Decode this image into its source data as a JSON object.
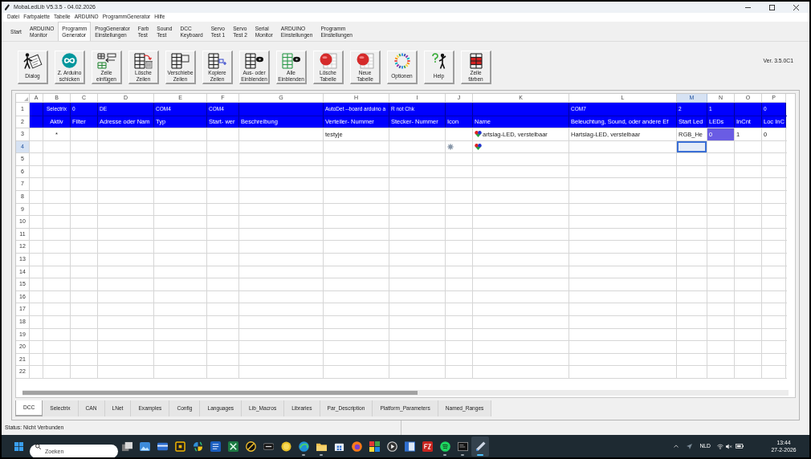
{
  "window": {
    "title": "MobaLedLib V5.3.5 - 04.02.2026"
  },
  "menu": [
    "Datei",
    "Farbpalette",
    "Tabelle",
    "ARDUINO",
    "ProgrammGenerator",
    "Hilfe"
  ],
  "tabs": [
    {
      "label": "Start",
      "selected": false
    },
    {
      "label": "ARDUINO\nMonitor",
      "selected": false
    },
    {
      "label": "Programm\nGenerator",
      "selected": true
    },
    {
      "label": "ProgGenerator\nEinstellungen",
      "selected": false
    },
    {
      "label": "Farb\nTest",
      "selected": false
    },
    {
      "label": "Sound\nTest",
      "selected": false
    },
    {
      "label": "DCC\nKeyboard",
      "selected": false
    },
    {
      "label": "Servo\nTest 1",
      "selected": false
    },
    {
      "label": "Servo\nTest 2",
      "selected": false
    },
    {
      "label": "Serial\nMonitor",
      "selected": false
    },
    {
      "label": "ARDUINO\nEinstellungen",
      "selected": false
    },
    {
      "label": "Programm\nEinstellungen",
      "selected": false
    }
  ],
  "toolbar": {
    "buttons": [
      {
        "kind": "dialog",
        "label": "Dialog"
      },
      {
        "kind": "upload",
        "label": "Z. Arduino\nschicken"
      },
      {
        "kind": "insert",
        "label": "Zeile\neinfügen"
      },
      {
        "kind": "delete",
        "label": "Lösche\nZeilen"
      },
      {
        "kind": "move",
        "label": "Verschiebe\nZeilen"
      },
      {
        "kind": "copy",
        "label": "Kopiere\nZeilen"
      },
      {
        "kind": "toggle",
        "label": "Aus- oder\nEinblenden"
      },
      {
        "kind": "show",
        "label": "Alle\nEinblenden"
      },
      {
        "kind": "clear",
        "label": "Lösche\nTabelle"
      },
      {
        "kind": "new",
        "label": "Neue\nTabelle"
      },
      {
        "kind": "options",
        "label": "Optionen"
      },
      {
        "kind": "help",
        "label": "Help"
      },
      {
        "kind": "paint",
        "label": "Zeile\nfärben"
      }
    ],
    "version": "Ver. 3.5.0C1"
  },
  "sheet": {
    "columns": [
      {
        "label": "A",
        "selected": false
      },
      {
        "label": "B",
        "selected": false
      },
      {
        "label": "C",
        "selected": false
      },
      {
        "label": "D",
        "selected": false
      },
      {
        "label": "E",
        "selected": false
      },
      {
        "label": "F",
        "selected": false
      },
      {
        "label": "G",
        "selected": false
      },
      {
        "label": "H",
        "selected": false
      },
      {
        "label": "I",
        "selected": false
      },
      {
        "label": "J",
        "selected": false
      },
      {
        "label": "K",
        "selected": false
      },
      {
        "label": "L",
        "selected": false
      },
      {
        "label": "M",
        "selected": true
      },
      {
        "label": "N",
        "selected": false
      },
      {
        "label": "O",
        "selected": false
      },
      {
        "label": "P",
        "selected": false
      }
    ],
    "rows": [
      {
        "number": "1",
        "kind": "config",
        "selected": false,
        "cells": [
          null,
          {
            "text": "Selectrix"
          },
          {
            "text": "0"
          },
          {
            "text": "DE"
          },
          {
            "text": "COM4"
          },
          {
            "text": "COM4"
          },
          null,
          {
            "text": "AutoDet --board arduino a"
          },
          {
            "text": "R not Chk"
          },
          null,
          null,
          {
            "text": "COM7"
          },
          {
            "text": "2"
          },
          {
            "text": "1"
          },
          null,
          {
            "text": "0"
          }
        ]
      },
      {
        "number": "2",
        "kind": "header",
        "selected": false,
        "cells": [
          null,
          {
            "text": "Aktiv"
          },
          {
            "text": "Filter"
          },
          {
            "text": "Adresse oder Nam"
          },
          {
            "text": "Typ"
          },
          {
            "text": "Start- wer"
          },
          {
            "text": "Beschreibung"
          },
          {
            "text": "Verteiler- Nummer"
          },
          {
            "text": "Stecker- Nummer"
          },
          {
            "text": "Icon"
          },
          {
            "text": "Name"
          },
          {
            "text": "Beleuchtung, Sound, oder andere Ef"
          },
          {
            "text": "Start Led"
          },
          {
            "text": "LEDs"
          },
          {
            "text": "InCnt"
          },
          {
            "text": "Loc InC"
          }
        ]
      },
      {
        "number": "3",
        "kind": "data",
        "selected": false,
        "cells": [
          null,
          {
            "text": "*"
          },
          null,
          null,
          null,
          null,
          null,
          {
            "text": "testyje"
          },
          null,
          null,
          {
            "kind": "led",
            "text": "artslag-LED, verstelbaar"
          },
          {
            "text": "Hartslag-LED, verstelbaar"
          },
          {
            "text": "RGB_He"
          },
          {
            "text": "0",
            "color": "#6a5ce4"
          },
          {
            "text": "1"
          },
          {
            "text": "0"
          }
        ]
      },
      {
        "number": "4",
        "kind": "data",
        "selected": true,
        "cells": [
          null,
          null,
          null,
          null,
          null,
          null,
          null,
          null,
          null,
          {
            "kind": "symbol"
          },
          {
            "kind": "led"
          },
          null,
          null,
          null,
          null,
          null
        ]
      },
      {
        "number": "5",
        "kind": "data",
        "selected": false
      },
      {
        "number": "6",
        "kind": "data",
        "selected": false
      },
      {
        "number": "7",
        "kind": "data",
        "selected": false
      },
      {
        "number": "8",
        "kind": "data",
        "selected": false
      },
      {
        "number": "9",
        "kind": "data",
        "selected": false
      },
      {
        "number": "10",
        "kind": "data",
        "selected": false
      },
      {
        "number": "11",
        "kind": "data",
        "selected": false
      },
      {
        "number": "12",
        "kind": "data",
        "selected": false
      },
      {
        "number": "13",
        "kind": "data",
        "selected": false
      },
      {
        "number": "14",
        "kind": "data",
        "selected": false
      },
      {
        "number": "15",
        "kind": "data",
        "selected": false
      },
      {
        "number": "16",
        "kind": "data",
        "selected": false
      },
      {
        "number": "17",
        "kind": "data",
        "selected": false
      },
      {
        "number": "18",
        "kind": "data",
        "selected": false
      },
      {
        "number": "19",
        "kind": "data",
        "selected": false
      },
      {
        "number": "20",
        "kind": "data",
        "selected": false
      },
      {
        "number": "21",
        "kind": "data",
        "selected": false
      },
      {
        "number": "22",
        "kind": "data",
        "selected": false
      }
    ]
  },
  "sheet_tabs": [
    {
      "label": "DCC",
      "selected": true
    },
    {
      "label": "Selectrix",
      "selected": false
    },
    {
      "label": "CAN",
      "selected": false
    },
    {
      "label": "LNet",
      "selected": false
    },
    {
      "label": "Examples",
      "selected": false
    },
    {
      "label": "Config",
      "selected": false
    },
    {
      "label": "Languages",
      "selected": false
    },
    {
      "label": "Lib_Macros",
      "selected": false
    },
    {
      "label": "Libraries",
      "selected": false
    },
    {
      "label": "Par_Description",
      "selected": false
    },
    {
      "label": "Platform_Parameters",
      "selected": false
    },
    {
      "label": "Named_Ranges",
      "selected": false
    }
  ],
  "status_bar": "Status: Nicht Verbunden",
  "taskbar": {
    "search": {
      "placeholder": "Zoeken"
    },
    "apps": [
      {
        "kind": "tasks",
        "running": false,
        "active": false
      },
      {
        "kind": "photos",
        "running": false,
        "active": false
      },
      {
        "kind": "card",
        "running": false,
        "active": false
      },
      {
        "kind": "frame",
        "running": false,
        "active": false
      },
      {
        "kind": "twin",
        "running": false,
        "active": false
      },
      {
        "kind": "word",
        "running": false,
        "active": false
      },
      {
        "kind": "excel",
        "running": false,
        "active": false
      },
      {
        "kind": "compass",
        "running": false,
        "active": false
      },
      {
        "kind": "badge",
        "running": false,
        "active": false
      },
      {
        "kind": "coin",
        "running": false,
        "active": false
      },
      {
        "kind": "browser",
        "running": true,
        "active": false
      },
      {
        "kind": "folder",
        "running": true,
        "active": false
      },
      {
        "kind": "store",
        "running": false,
        "active": false
      },
      {
        "kind": "fox",
        "running": false,
        "active": false
      },
      {
        "kind": "tiles",
        "running": false,
        "active": false
      },
      {
        "kind": "player",
        "running": false,
        "active": false
      },
      {
        "kind": "panel",
        "running": false,
        "active": false
      },
      {
        "kind": "transfer",
        "running": false,
        "active": false
      },
      {
        "kind": "music",
        "running": true,
        "active": false
      },
      {
        "kind": "terminal",
        "running": true,
        "active": false
      },
      {
        "kind": "pen",
        "running": true,
        "active": true
      }
    ],
    "tray": {
      "language": "NLD",
      "time": "13:44",
      "date": "27-2-2026"
    }
  }
}
